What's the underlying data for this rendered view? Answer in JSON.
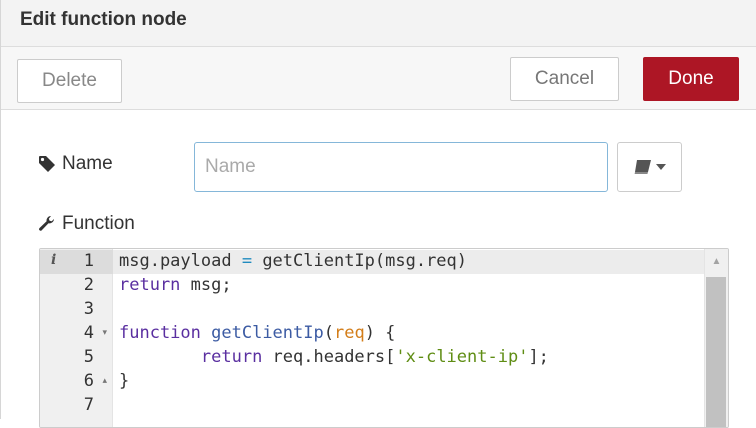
{
  "dialog": {
    "title": "Edit function node"
  },
  "toolbar": {
    "delete_label": "Delete",
    "cancel_label": "Cancel",
    "done_label": "Done"
  },
  "form": {
    "name_label": "Name",
    "name_value": "",
    "name_placeholder": "Name",
    "function_label": "Function",
    "library_button_icon": "book-icon"
  },
  "editor": {
    "lines": [
      {
        "number": "1",
        "fold": "",
        "active": true
      },
      {
        "number": "2",
        "fold": "",
        "active": false
      },
      {
        "number": "3",
        "fold": "",
        "active": false
      },
      {
        "number": "4",
        "fold": "▾",
        "active": false
      },
      {
        "number": "5",
        "fold": "",
        "active": false
      },
      {
        "number": "6",
        "fold": "▴",
        "active": false
      },
      {
        "number": "7",
        "fold": "",
        "active": false
      }
    ],
    "code": [
      [
        {
          "t": "msg.payload ",
          "c": ""
        },
        {
          "t": "=",
          "c": "op"
        },
        {
          "t": " getClientIp(msg.req)",
          "c": ""
        }
      ],
      [
        {
          "t": "return",
          "c": "kw"
        },
        {
          "t": " msg;",
          "c": ""
        }
      ],
      [],
      [
        {
          "t": "function",
          "c": "kw"
        },
        {
          "t": " ",
          "c": ""
        },
        {
          "t": "getClientIp",
          "c": "fn"
        },
        {
          "t": "(",
          "c": ""
        },
        {
          "t": "req",
          "c": "param"
        },
        {
          "t": ") {",
          "c": ""
        }
      ],
      [
        {
          "t": "        ",
          "c": ""
        },
        {
          "t": "return",
          "c": "kw"
        },
        {
          "t": " req.headers[",
          "c": ""
        },
        {
          "t": "'x-client-ip'",
          "c": "str"
        },
        {
          "t": "];",
          "c": ""
        }
      ],
      [
        {
          "t": "}",
          "c": ""
        }
      ],
      []
    ],
    "colors": {
      "keyword": "#5a2fa0",
      "function_name": "#3c5ba3",
      "parameter": "#d37d19",
      "string": "#5f8d14",
      "operator": "#1f8bbf"
    }
  },
  "colors": {
    "done_button": "#ad1625",
    "input_focus_border": "#85b7d9"
  }
}
